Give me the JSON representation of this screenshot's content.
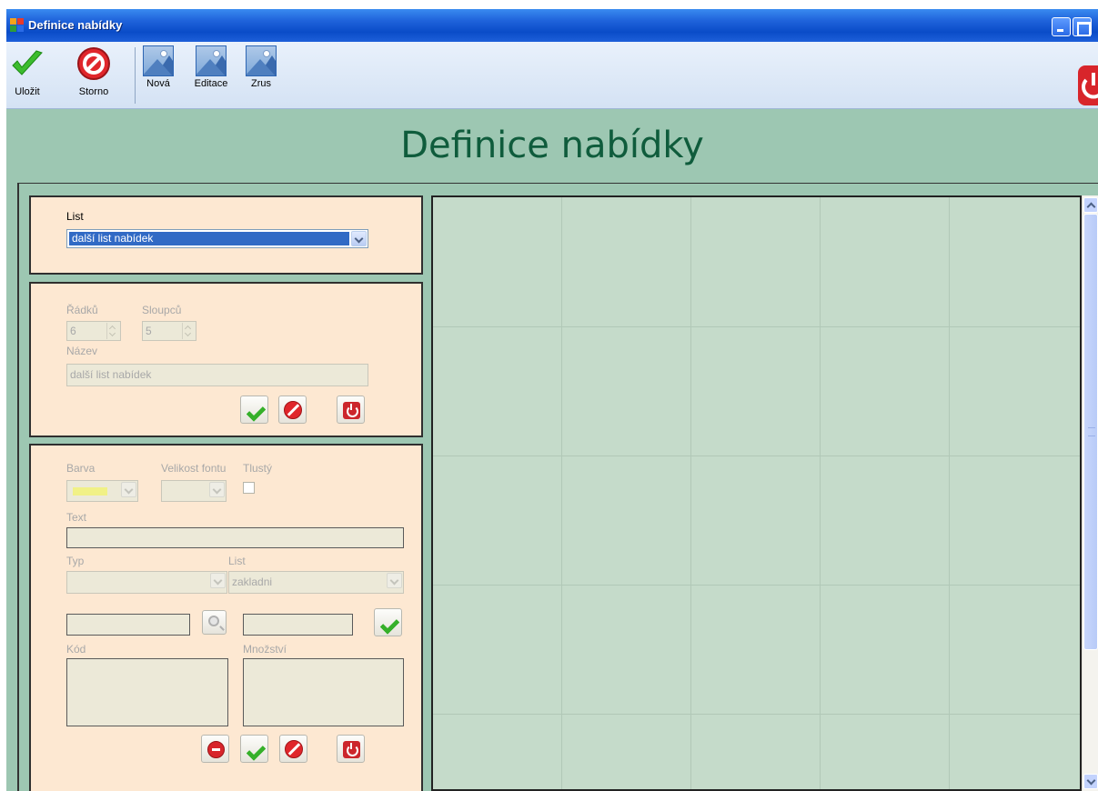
{
  "window": {
    "title": "Definice nabídky",
    "colors": {
      "titlebar": "#1f63db",
      "header_band": "#9dc7b2",
      "panel_bg": "#fde8d2",
      "grid_bg": "#c5dbca",
      "title_text": "#0f5c3c"
    }
  },
  "toolbar": {
    "save_label": "Uložit",
    "cancel_label": "Storno",
    "new_label": "Nová",
    "edit_label": "Editace",
    "delete_label": "Zrus",
    "icons": {
      "save": "check-icon",
      "cancel": "cancel-icon",
      "new": "image-icon",
      "edit": "image-icon",
      "delete": "image-icon",
      "exit": "power-icon"
    }
  },
  "header": {
    "title": "Definice nabídky"
  },
  "list_panel": {
    "label": "List",
    "selected": "další list nabídek"
  },
  "sheet_panel": {
    "rows_label": "Řádků",
    "rows_value": "6",
    "cols_label": "Sloupců",
    "cols_value": "5",
    "name_label": "Název",
    "name_value": "další list nabídek"
  },
  "item_panel": {
    "color_label": "Barva",
    "color_value": "#f1f186",
    "fontsize_label": "Velikost fontu",
    "bold_label": "Tlustý",
    "text_label": "Text",
    "text_value": "",
    "type_label": "Typ",
    "type_value": "",
    "list_label": "List",
    "list_value": "zakladni",
    "code_label": "Kód",
    "qty_label": "Množství"
  },
  "grid": {
    "rows": 6,
    "cols": 5
  }
}
